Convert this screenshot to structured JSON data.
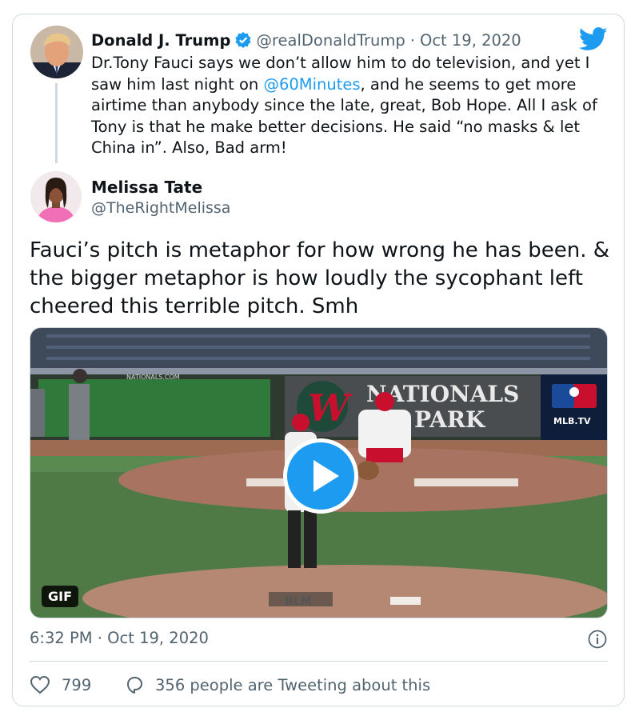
{
  "quoted_tweet": {
    "name": "Donald J. Trump",
    "handle": "@realDonaldTrump",
    "separator": "·",
    "date": "Oct 19, 2020",
    "text_before_mention": "Dr.Tony Fauci says we don’t allow him to do television, and yet I saw him last night on ",
    "mention": "@60Minutes",
    "text_after_mention": ", and he seems to get more airtime than anybody since the late, great, Bob Hope. All I ask of Tony is that he make better decisions. He said “no masks & let China in”. Also, Bad arm!",
    "verified_icon": "verified-badge-icon"
  },
  "tweet": {
    "name": "Melissa Tate",
    "handle": "@TheRightMelissa",
    "text": "Fauci’s pitch is metaphor for how wrong he has been. & the bigger metaphor is how loudly the sycophant left cheered this terrible pitch. Smh",
    "timestamp": "6:32 PM · Oct 19, 2020"
  },
  "media": {
    "badge": "GIF",
    "stadium_text": "NATIONALS",
    "stadium_text_2": "PARK",
    "logo_letter": "W",
    "mlb_text": "MLB.TV",
    "mound_text": "BLM",
    "sign_text": "NATIONALS.COM",
    "play_icon": "play-icon"
  },
  "actions": {
    "likes": "799",
    "replies": "356 people are Tweeting about this"
  },
  "icons": {
    "brand": "twitter-bird-icon",
    "info": "info-icon",
    "heart": "heart-icon",
    "reply": "reply-bubble-icon"
  },
  "colors": {
    "accent": "#1d9bf0",
    "text": "#0f1419",
    "muted": "#536471",
    "border": "#cfd9de"
  }
}
